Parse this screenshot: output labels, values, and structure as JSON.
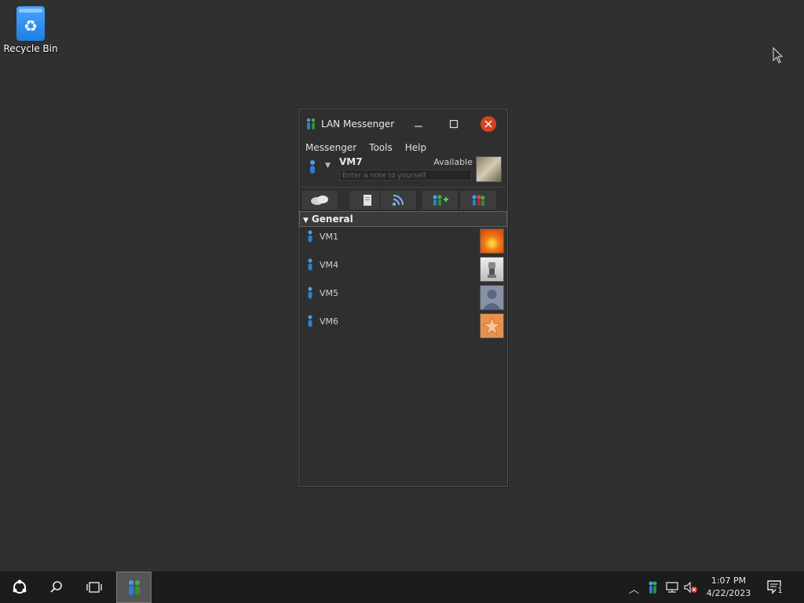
{
  "desktop": {
    "recycle_bin_label": "Recycle Bin"
  },
  "window": {
    "title": "LAN Messenger",
    "menu": [
      "Messenger",
      "Tools",
      "Help"
    ],
    "profile": {
      "name": "VM7",
      "status": "Available",
      "note_placeholder": "Enter a note to yourself"
    },
    "toolbar": [
      {
        "name": "chat-icon"
      },
      {
        "name": "file-transfer-icon"
      },
      {
        "name": "broadcast-icon"
      },
      {
        "name": "add-contact-icon"
      },
      {
        "name": "group-icon"
      }
    ],
    "group": {
      "name": "General",
      "contacts": [
        {
          "name": "VM1",
          "avatar_color": "#f07a18"
        },
        {
          "name": "VM4",
          "avatar_color": "#bdbdbd"
        },
        {
          "name": "VM5",
          "avatar_color": "#7f8aa3"
        },
        {
          "name": "VM6",
          "avatar_color": "#e8914a"
        }
      ]
    }
  },
  "taskbar": {
    "time": "1:07 PM",
    "date": "4/22/2023",
    "notification_count": "1"
  },
  "colors": {
    "close_button": "#d5441c",
    "desktop": "#303030",
    "taskbar": "#1c1c1c"
  }
}
